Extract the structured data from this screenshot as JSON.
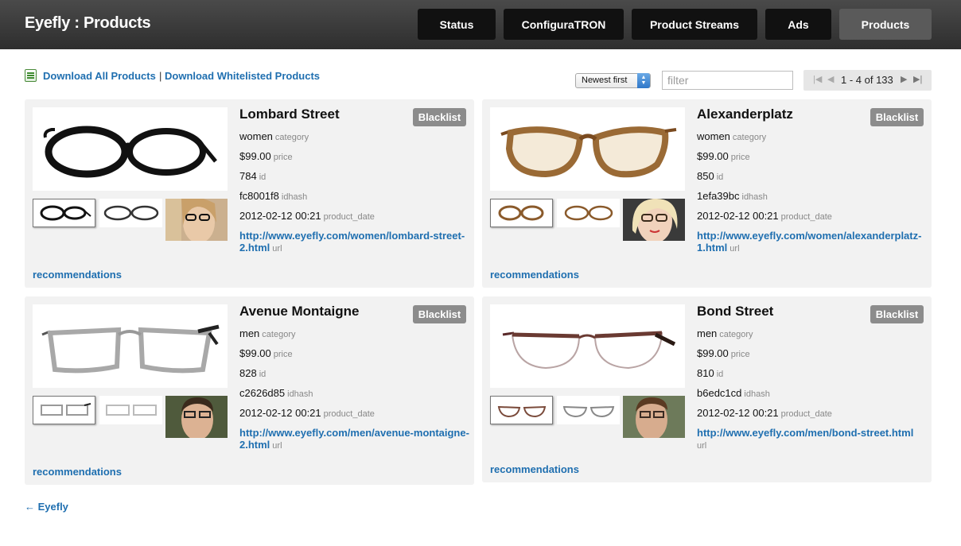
{
  "header": {
    "title": "Eyefly : Products",
    "nav": [
      {
        "label": "Status"
      },
      {
        "label": "ConfiguraTRON"
      },
      {
        "label": "Product Streams"
      },
      {
        "label": "Ads"
      },
      {
        "label": "Products"
      }
    ]
  },
  "toolbar": {
    "download_all": "Download All Products",
    "separator": "|",
    "download_whitelisted": "Download Whitelisted Products",
    "sort_value": "Newest first",
    "filter_placeholder": "filter",
    "pager_text": "1 - 4 of 133"
  },
  "labels": {
    "category": "category",
    "price": "price",
    "id": "id",
    "idhash": "idhash",
    "product_date": "product_date",
    "url": "url",
    "blacklist": "Blacklist",
    "recommendations": "recommendations"
  },
  "products": [
    {
      "name": "Lombard Street",
      "category": "women",
      "price": "$99.00",
      "id": "784",
      "idhash": "fc8001f8",
      "product_date": "2012-02-12 00:21",
      "url": "http://www.eyefly.com/women/lombard-street-2.html",
      "frame_color": "#111111"
    },
    {
      "name": "Alexanderplatz",
      "category": "women",
      "price": "$99.00",
      "id": "850",
      "idhash": "1efa39bc",
      "product_date": "2012-02-12 00:21",
      "url": "http://www.eyefly.com/women/alexanderplatz-1.html",
      "frame_color": "#8a5a2b"
    },
    {
      "name": "Avenue Montaigne",
      "category": "men",
      "price": "$99.00",
      "id": "828",
      "idhash": "c2626d85",
      "product_date": "2012-02-12 00:21",
      "url": "http://www.eyefly.com/men/avenue-montaigne-2.html",
      "frame_color": "#9a9a9a"
    },
    {
      "name": "Bond Street",
      "category": "men",
      "price": "$99.00",
      "id": "810",
      "idhash": "b6edc1cd",
      "product_date": "2012-02-12 00:21",
      "url": "http://www.eyefly.com/men/bond-street.html",
      "frame_color": "#5a3a2a"
    }
  ],
  "footer": {
    "back_link": "← Eyefly"
  },
  "colors": {
    "link": "#1f6fb0",
    "topbar": "#3a3a3a",
    "card_bg": "#f2f2f2",
    "blacklist_bg": "#8c8c8c"
  }
}
